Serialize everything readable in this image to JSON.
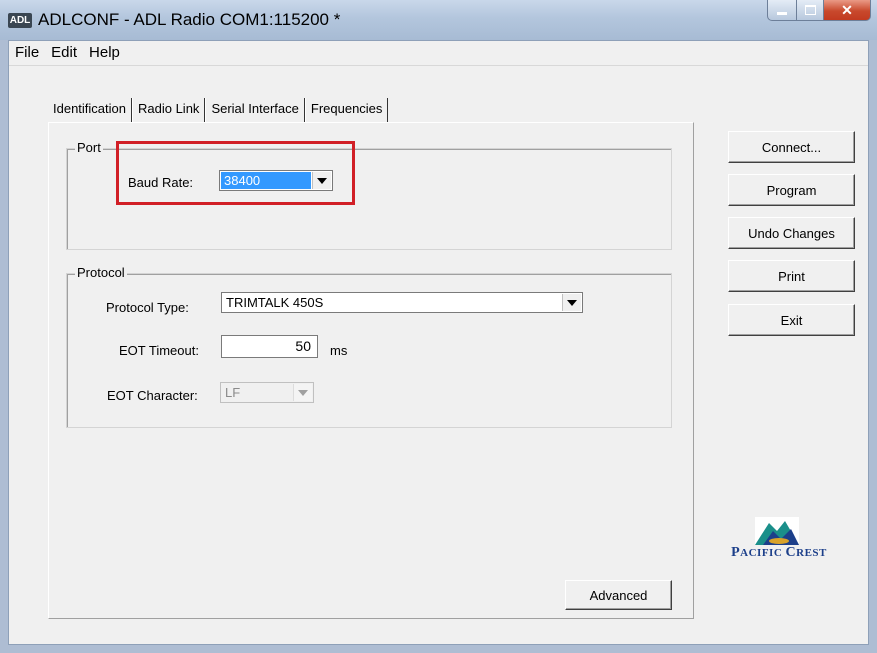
{
  "window": {
    "app_icon_text": "ADL",
    "title": "ADLCONF - ADL Radio COM1:115200 *"
  },
  "menubar": {
    "items": [
      "File",
      "Edit",
      "Help"
    ]
  },
  "tabs": {
    "items": [
      "Identification",
      "Radio Link",
      "Serial Interface",
      "Frequencies"
    ],
    "active": "Serial Interface"
  },
  "port": {
    "group_label": "Port",
    "baud_rate_label": "Baud Rate:",
    "baud_rate_value": "38400"
  },
  "protocol": {
    "group_label": "Protocol",
    "type_label": "Protocol Type:",
    "type_value": "TRIMTALK 450S",
    "eot_timeout_label": "EOT Timeout:",
    "eot_timeout_value": "50",
    "eot_timeout_unit": "ms",
    "eot_character_label": "EOT Character:",
    "eot_character_value": "LF"
  },
  "buttons": {
    "connect": "Connect...",
    "program": "Program",
    "undo": "Undo Changes",
    "print": "Print",
    "exit": "Exit",
    "advanced": "Advanced"
  },
  "logo": {
    "text_first": "P",
    "text_first_rest": "ACIFIC ",
    "text_second": "C",
    "text_second_rest": "REST",
    "colors": {
      "navy": "#1c3f8a",
      "teal": "#1a8f8a",
      "gold": "#d8a22a"
    }
  },
  "colors": {
    "highlight_box": "#d11f26",
    "selection": "#3399ff"
  }
}
